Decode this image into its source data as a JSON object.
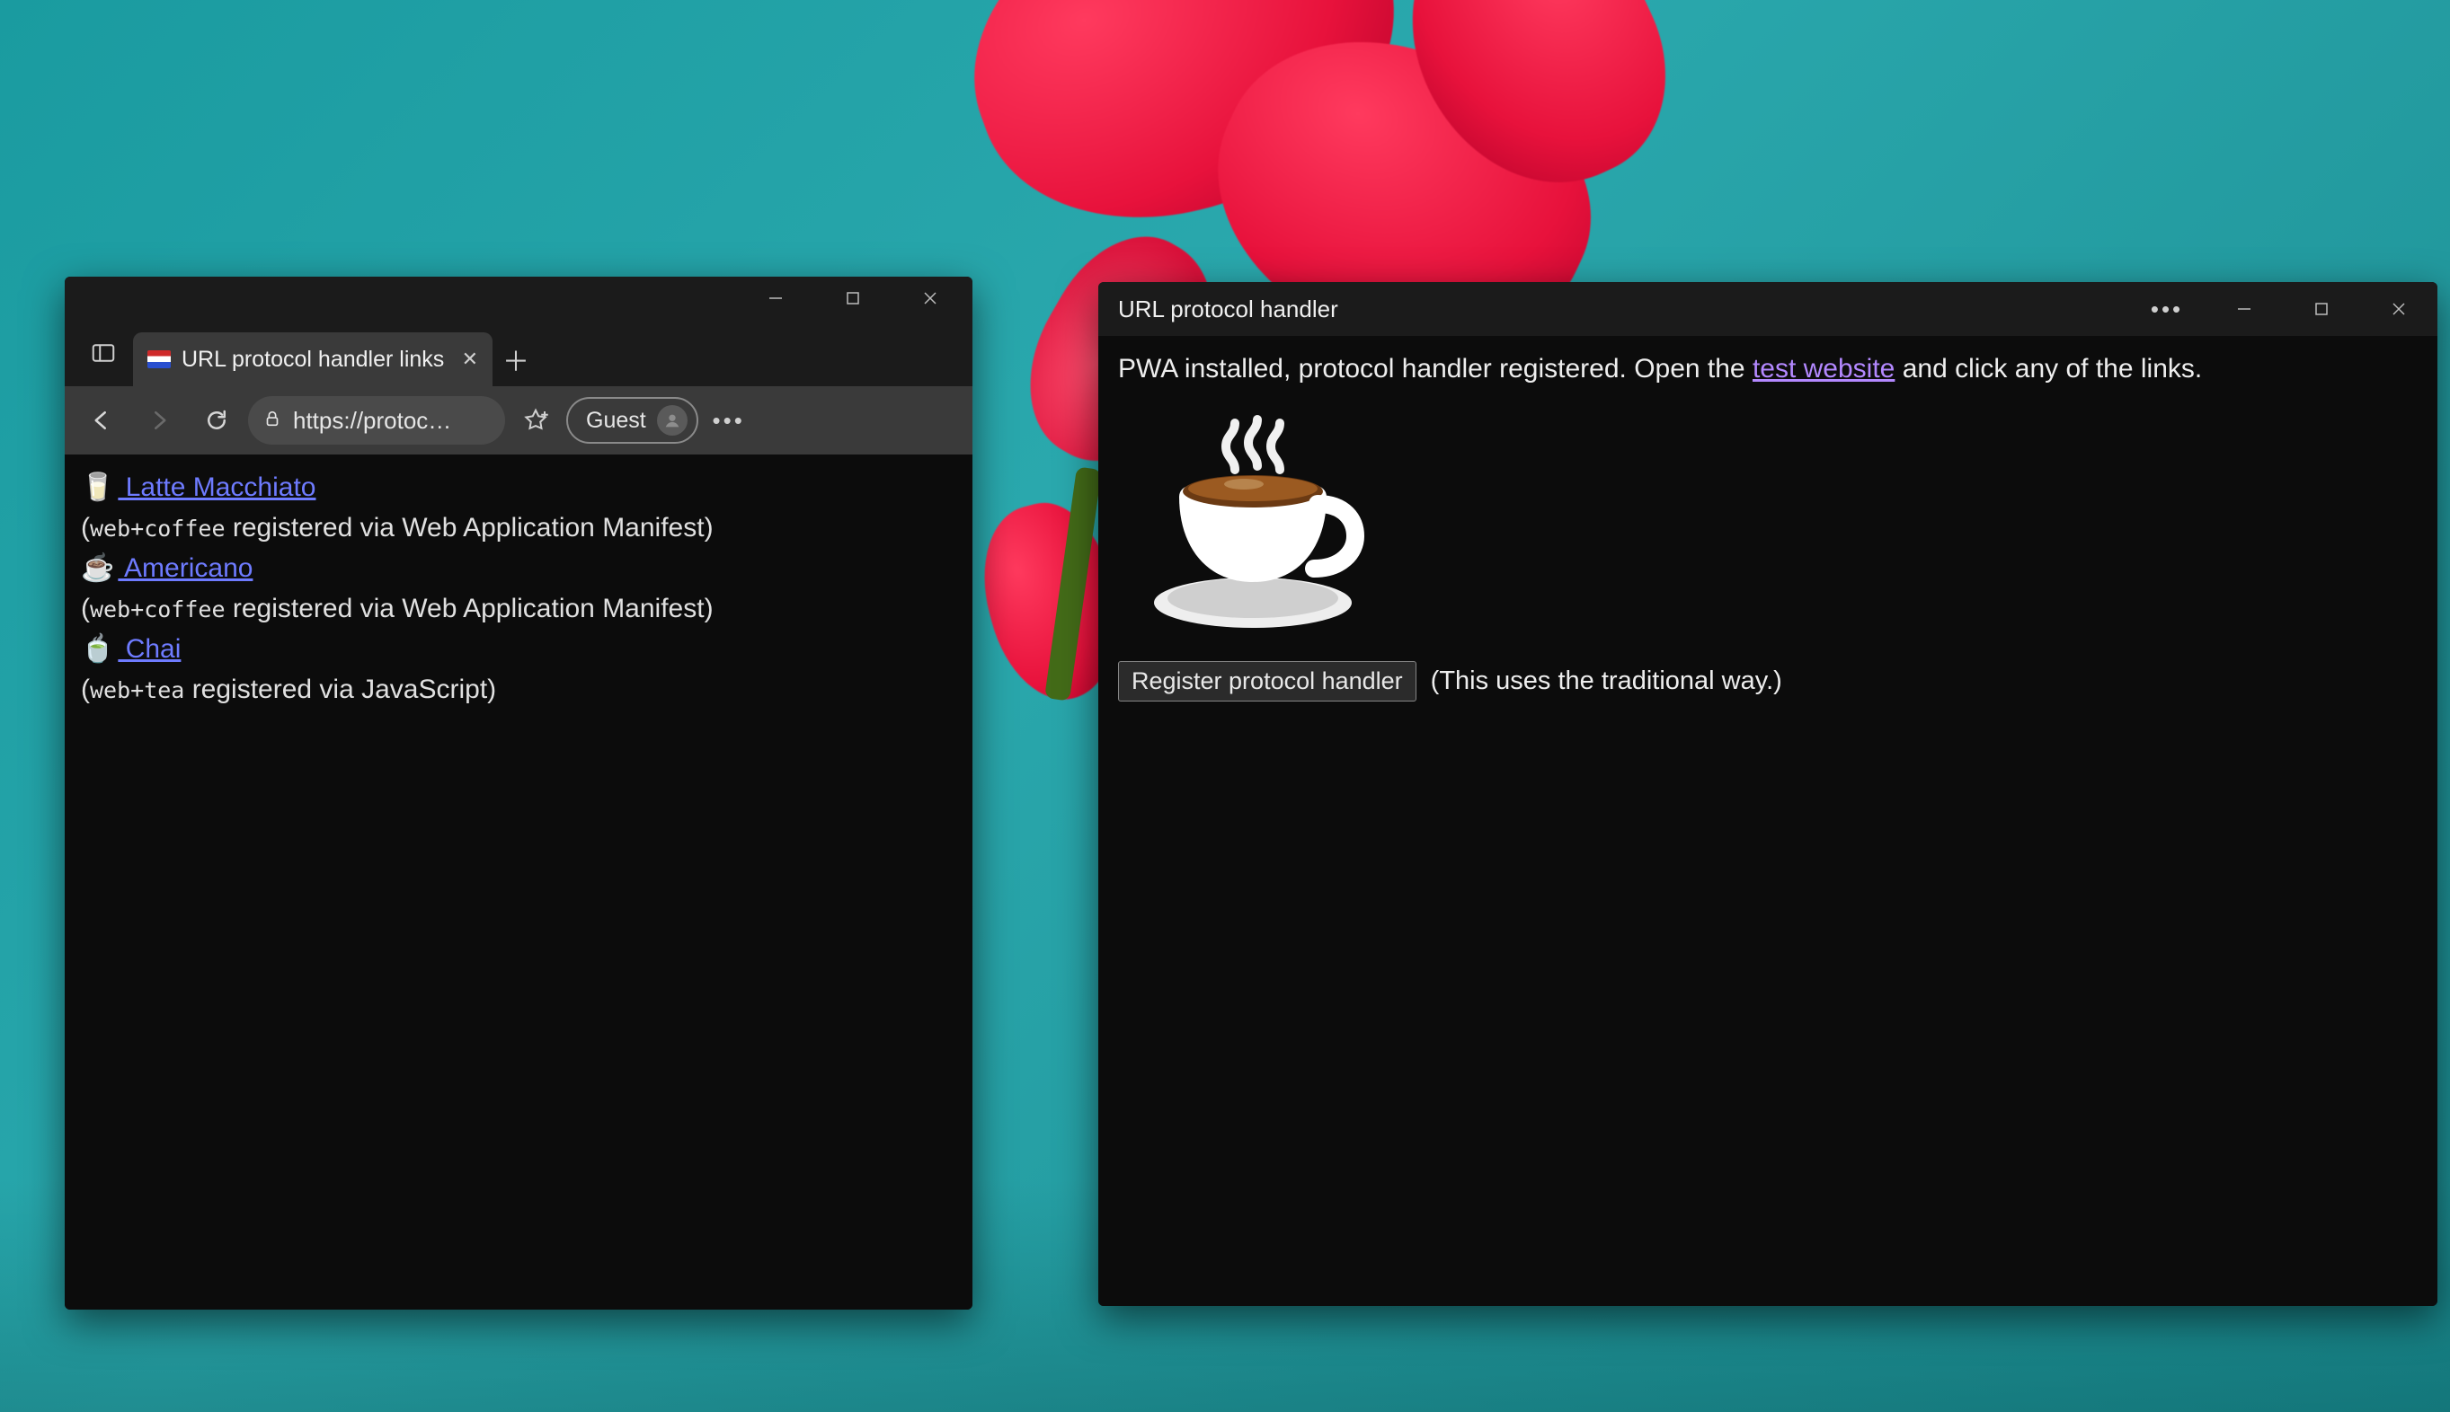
{
  "leftWindow": {
    "tab": {
      "title": "URL protocol handler links"
    },
    "addressBar": {
      "url": "https://protoc…"
    },
    "guestLabel": "Guest",
    "page": {
      "links": [
        {
          "emoji": "🥛",
          "text": " Latte Macchiato",
          "regNote": "(",
          "proto": "web+coffee",
          "regTail": " registered via Web Application Manifest)"
        },
        {
          "emoji": "☕",
          "text": " Americano",
          "regNote": "(",
          "proto": "web+coffee",
          "regTail": " registered via Web Application Manifest)"
        },
        {
          "emoji": "🍵",
          "text": " Chai",
          "regNote": "(",
          "proto": "web+tea",
          "regTail": " registered via JavaScript)"
        }
      ]
    }
  },
  "rightWindow": {
    "title": "URL protocol handler",
    "intro": {
      "before": "PWA installed, protocol handler registered. Open the ",
      "link": "test website",
      "after": " and click any of the links."
    },
    "registerButton": "Register protocol handler",
    "registerNote": "(This uses the traditional way.)"
  }
}
